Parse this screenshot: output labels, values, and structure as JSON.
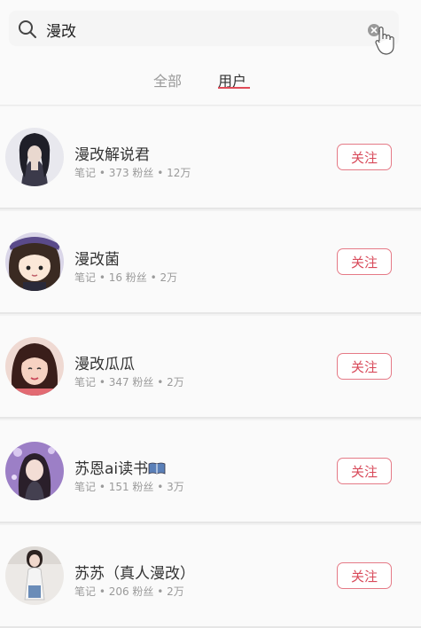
{
  "search": {
    "value": "漫改",
    "icon": "search-icon",
    "clear_icon": "clear-icon"
  },
  "tabs": [
    {
      "label": "全部",
      "active": false
    },
    {
      "label": "用户",
      "active": true
    }
  ],
  "accent_color": "#e04a58",
  "users": [
    {
      "name": "漫改解说君",
      "meta": "笔记 • 373 粉丝 • 12万",
      "follow_label": "关注"
    },
    {
      "name": "漫改菌",
      "meta": "笔记 • 16 粉丝 • 2万",
      "follow_label": "关注"
    },
    {
      "name": "漫改瓜瓜",
      "meta": "笔记 • 347 粉丝 • 2万",
      "follow_label": "关注"
    },
    {
      "name": "苏恩ai读书",
      "name_icon": "book-icon",
      "meta": "笔记 • 151 粉丝 • 3万",
      "follow_label": "关注"
    },
    {
      "name": "苏苏（真人漫改）",
      "meta": "笔记 • 206 粉丝 • 2万",
      "follow_label": "关注"
    }
  ]
}
